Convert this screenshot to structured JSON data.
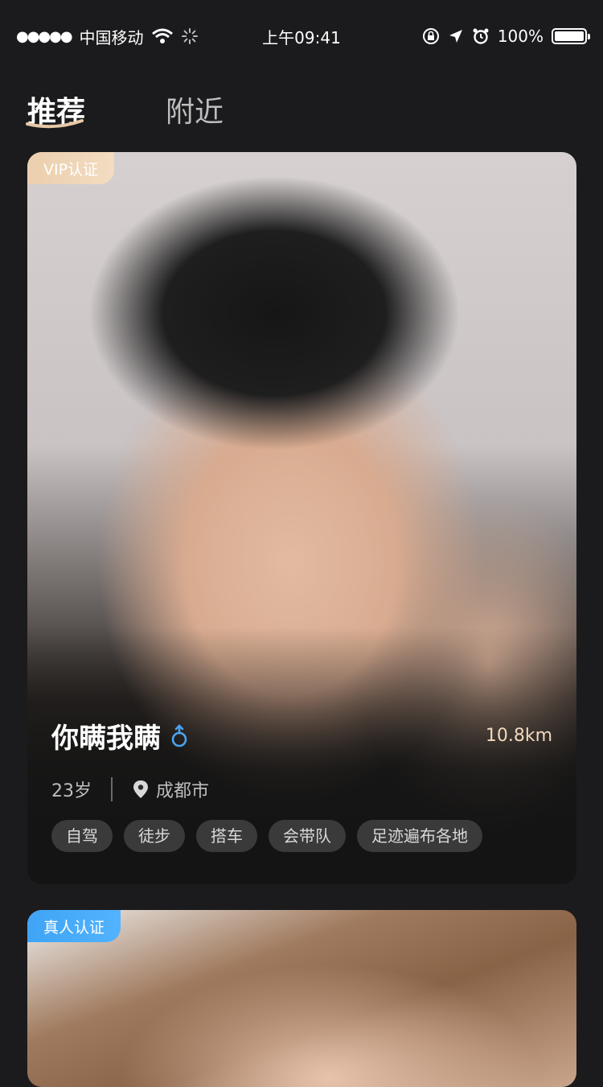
{
  "status_bar": {
    "signal_dots": "●●●●●",
    "carrier": "中国移动",
    "time": "上午09:41",
    "battery_percent": "100%",
    "icons": [
      "wifi-icon",
      "loading-icon",
      "orientation-lock-icon",
      "location-arrow-icon",
      "alarm-icon",
      "battery-icon"
    ]
  },
  "tabs": [
    {
      "label": "推荐",
      "active": true
    },
    {
      "label": "附近",
      "active": false
    }
  ],
  "cards": [
    {
      "badge": "VIP认证",
      "name": "你瞒我瞒",
      "gender_icon": "male-icon",
      "distance": "10.8km",
      "age": "23岁",
      "city": "成都市",
      "tags": [
        "自驾",
        "徒步",
        "搭车",
        "会带队",
        "足迹遍布各地"
      ]
    },
    {
      "badge": "真人认证"
    }
  ],
  "colors": {
    "background": "#1b1b1d",
    "vip_badge": "#ebcfae",
    "real_badge": "#3fa4f5",
    "male_icon": "#4aa3f0",
    "distance_text": "#f0d9bd",
    "tag_bg": "#3a3a3a"
  }
}
